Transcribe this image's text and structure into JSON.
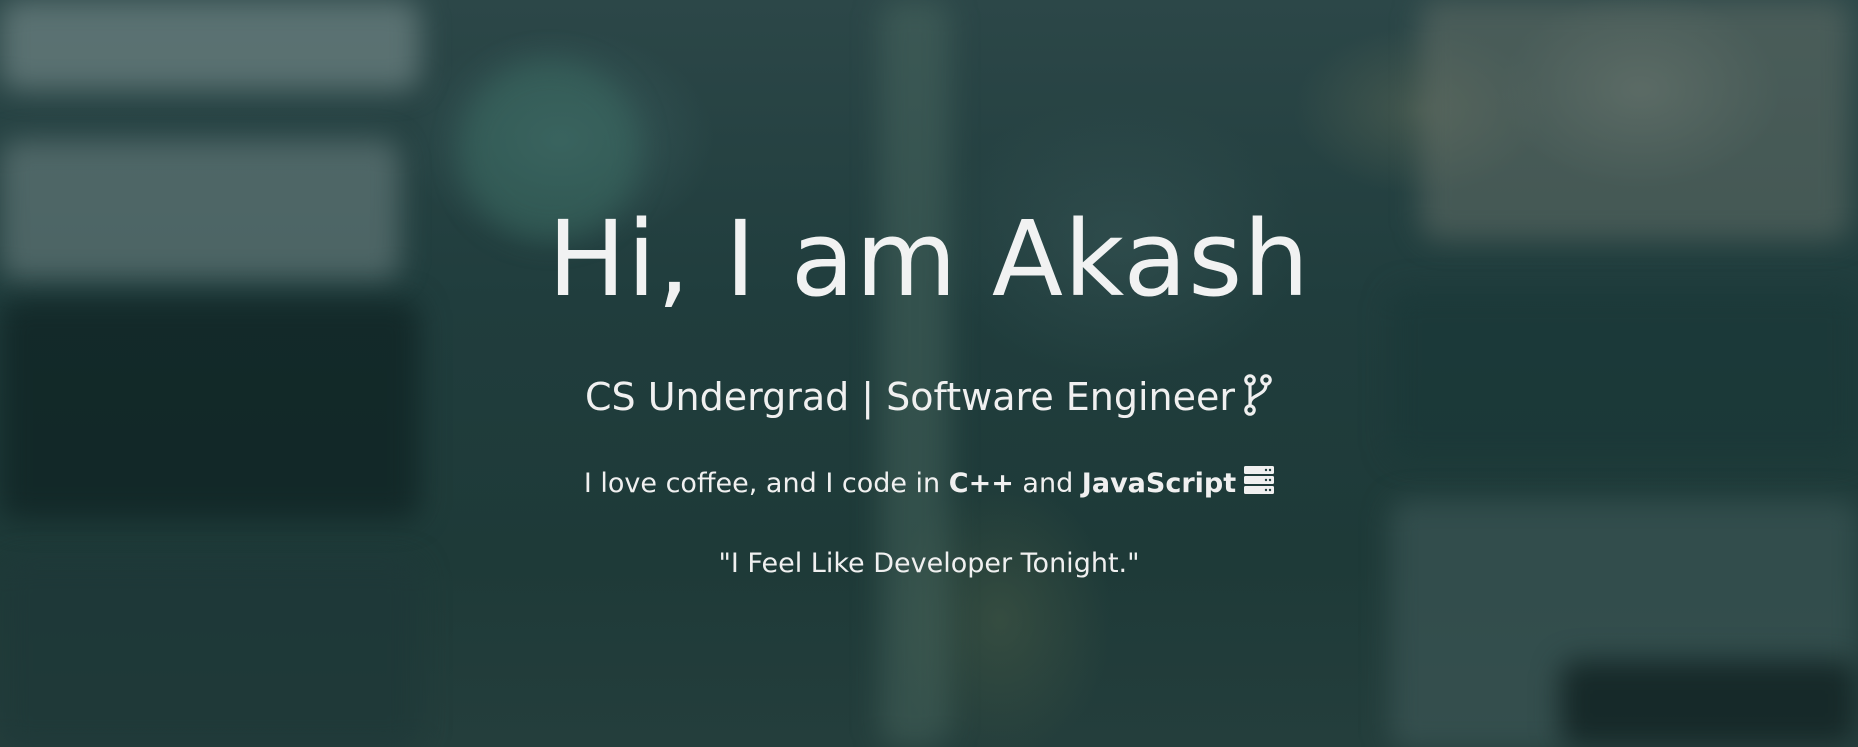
{
  "hero": {
    "title": "Hi, I am Akash",
    "subtitle": "CS Undergrad | Software Engineer",
    "subtitle_icon": "git-branch-icon",
    "tagline": {
      "prefix": "I love coffee, and I code in ",
      "lang1": "C++",
      "middle": " and ",
      "lang2": "JavaScript",
      "icon": "server-icon"
    },
    "quote": "\"I Feel Like Developer Tonight.\""
  },
  "colors": {
    "text": "#f2f2f2",
    "background": "#203d3d"
  }
}
